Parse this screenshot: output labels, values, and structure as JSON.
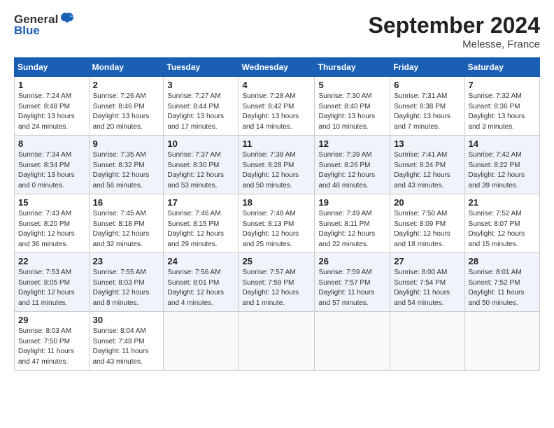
{
  "header": {
    "logo_general": "General",
    "logo_blue": "Blue",
    "month_title": "September 2024",
    "location": "Melesse, France"
  },
  "weekdays": [
    "Sunday",
    "Monday",
    "Tuesday",
    "Wednesday",
    "Thursday",
    "Friday",
    "Saturday"
  ],
  "weeks": [
    [
      {
        "day": "1",
        "info": "Sunrise: 7:24 AM\nSunset: 8:48 PM\nDaylight: 13 hours\nand 24 minutes."
      },
      {
        "day": "2",
        "info": "Sunrise: 7:26 AM\nSunset: 8:46 PM\nDaylight: 13 hours\nand 20 minutes."
      },
      {
        "day": "3",
        "info": "Sunrise: 7:27 AM\nSunset: 8:44 PM\nDaylight: 13 hours\nand 17 minutes."
      },
      {
        "day": "4",
        "info": "Sunrise: 7:28 AM\nSunset: 8:42 PM\nDaylight: 13 hours\nand 14 minutes."
      },
      {
        "day": "5",
        "info": "Sunrise: 7:30 AM\nSunset: 8:40 PM\nDaylight: 13 hours\nand 10 minutes."
      },
      {
        "day": "6",
        "info": "Sunrise: 7:31 AM\nSunset: 8:38 PM\nDaylight: 13 hours\nand 7 minutes."
      },
      {
        "day": "7",
        "info": "Sunrise: 7:32 AM\nSunset: 8:36 PM\nDaylight: 13 hours\nand 3 minutes."
      }
    ],
    [
      {
        "day": "8",
        "info": "Sunrise: 7:34 AM\nSunset: 8:34 PM\nDaylight: 13 hours\nand 0 minutes."
      },
      {
        "day": "9",
        "info": "Sunrise: 7:35 AM\nSunset: 8:32 PM\nDaylight: 12 hours\nand 56 minutes."
      },
      {
        "day": "10",
        "info": "Sunrise: 7:37 AM\nSunset: 8:30 PM\nDaylight: 12 hours\nand 53 minutes."
      },
      {
        "day": "11",
        "info": "Sunrise: 7:38 AM\nSunset: 8:28 PM\nDaylight: 12 hours\nand 50 minutes."
      },
      {
        "day": "12",
        "info": "Sunrise: 7:39 AM\nSunset: 8:26 PM\nDaylight: 12 hours\nand 46 minutes."
      },
      {
        "day": "13",
        "info": "Sunrise: 7:41 AM\nSunset: 8:24 PM\nDaylight: 12 hours\nand 43 minutes."
      },
      {
        "day": "14",
        "info": "Sunrise: 7:42 AM\nSunset: 8:22 PM\nDaylight: 12 hours\nand 39 minutes."
      }
    ],
    [
      {
        "day": "15",
        "info": "Sunrise: 7:43 AM\nSunset: 8:20 PM\nDaylight: 12 hours\nand 36 minutes."
      },
      {
        "day": "16",
        "info": "Sunrise: 7:45 AM\nSunset: 8:18 PM\nDaylight: 12 hours\nand 32 minutes."
      },
      {
        "day": "17",
        "info": "Sunrise: 7:46 AM\nSunset: 8:15 PM\nDaylight: 12 hours\nand 29 minutes."
      },
      {
        "day": "18",
        "info": "Sunrise: 7:48 AM\nSunset: 8:13 PM\nDaylight: 12 hours\nand 25 minutes."
      },
      {
        "day": "19",
        "info": "Sunrise: 7:49 AM\nSunset: 8:11 PM\nDaylight: 12 hours\nand 22 minutes."
      },
      {
        "day": "20",
        "info": "Sunrise: 7:50 AM\nSunset: 8:09 PM\nDaylight: 12 hours\nand 18 minutes."
      },
      {
        "day": "21",
        "info": "Sunrise: 7:52 AM\nSunset: 8:07 PM\nDaylight: 12 hours\nand 15 minutes."
      }
    ],
    [
      {
        "day": "22",
        "info": "Sunrise: 7:53 AM\nSunset: 8:05 PM\nDaylight: 12 hours\nand 11 minutes."
      },
      {
        "day": "23",
        "info": "Sunrise: 7:55 AM\nSunset: 8:03 PM\nDaylight: 12 hours\nand 8 minutes."
      },
      {
        "day": "24",
        "info": "Sunrise: 7:56 AM\nSunset: 8:01 PM\nDaylight: 12 hours\nand 4 minutes."
      },
      {
        "day": "25",
        "info": "Sunrise: 7:57 AM\nSunset: 7:59 PM\nDaylight: 12 hours\nand 1 minute."
      },
      {
        "day": "26",
        "info": "Sunrise: 7:59 AM\nSunset: 7:57 PM\nDaylight: 11 hours\nand 57 minutes."
      },
      {
        "day": "27",
        "info": "Sunrise: 8:00 AM\nSunset: 7:54 PM\nDaylight: 11 hours\nand 54 minutes."
      },
      {
        "day": "28",
        "info": "Sunrise: 8:01 AM\nSunset: 7:52 PM\nDaylight: 11 hours\nand 50 minutes."
      }
    ],
    [
      {
        "day": "29",
        "info": "Sunrise: 8:03 AM\nSunset: 7:50 PM\nDaylight: 11 hours\nand 47 minutes."
      },
      {
        "day": "30",
        "info": "Sunrise: 8:04 AM\nSunset: 7:48 PM\nDaylight: 11 hours\nand 43 minutes."
      },
      {
        "day": "",
        "info": ""
      },
      {
        "day": "",
        "info": ""
      },
      {
        "day": "",
        "info": ""
      },
      {
        "day": "",
        "info": ""
      },
      {
        "day": "",
        "info": ""
      }
    ]
  ]
}
